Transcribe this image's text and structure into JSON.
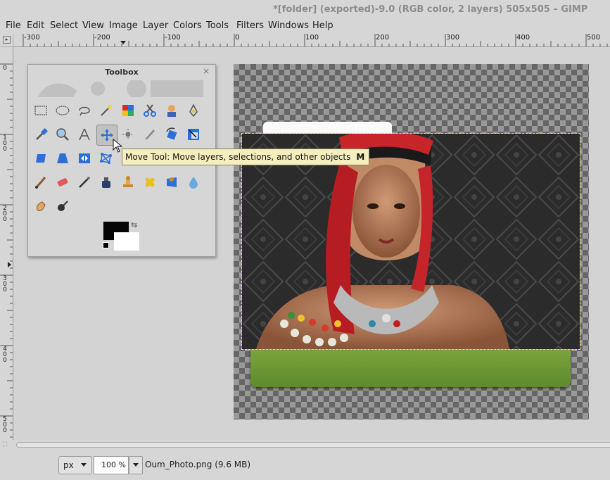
{
  "window": {
    "title": "*[folder] (exported)-9.0 (RGB color, 2 layers) 505x505 – GIMP"
  },
  "menu": [
    "File",
    "Edit",
    "Select",
    "View",
    "Image",
    "Layer",
    "Colors",
    "Tools",
    "Filters",
    "Windows",
    "Help"
  ],
  "ruler": {
    "horizontal": [
      "-300",
      "-200",
      "-100",
      "0",
      "100",
      "200",
      "300",
      "400",
      "500"
    ],
    "vertical": [
      "0",
      "1\n0\n0",
      "2\n0\n0",
      "3\n0\n0",
      "4\n0\n0",
      "5\n0\n0"
    ]
  },
  "toolbox": {
    "title": "Toolbox",
    "close": "×",
    "tools": [
      "rect-select",
      "ellipse-select",
      "free-select",
      "fuzzy-select",
      "select-by-color",
      "scissors-select",
      "foreground-select",
      "paths",
      "color-picker",
      "zoom",
      "measure",
      "move",
      "alignment",
      "transform",
      "transform-layer",
      "perspective",
      "flip",
      "cage",
      "warp",
      "smudge",
      "heal",
      "clone",
      "perspective-clone",
      "blur",
      "paintbrush",
      "eraser",
      "airbrush",
      "ink",
      "mypaint-brush",
      "clone-stamp",
      "bucket-fill",
      "dodge",
      "smudge2",
      "dodge-burn"
    ]
  },
  "tooltip": {
    "text": "Move Tool: Move layers, selections, and other objects",
    "shortcut": "M"
  },
  "colors": {
    "foreground": "#050505",
    "background": "#ffffff",
    "selection": "#f2e24a",
    "green": "#6e9a35"
  },
  "statusbar": {
    "unit": "px",
    "zoom": "100 %",
    "file_info": "Oum_Photo.png (9.6 MB)"
  }
}
